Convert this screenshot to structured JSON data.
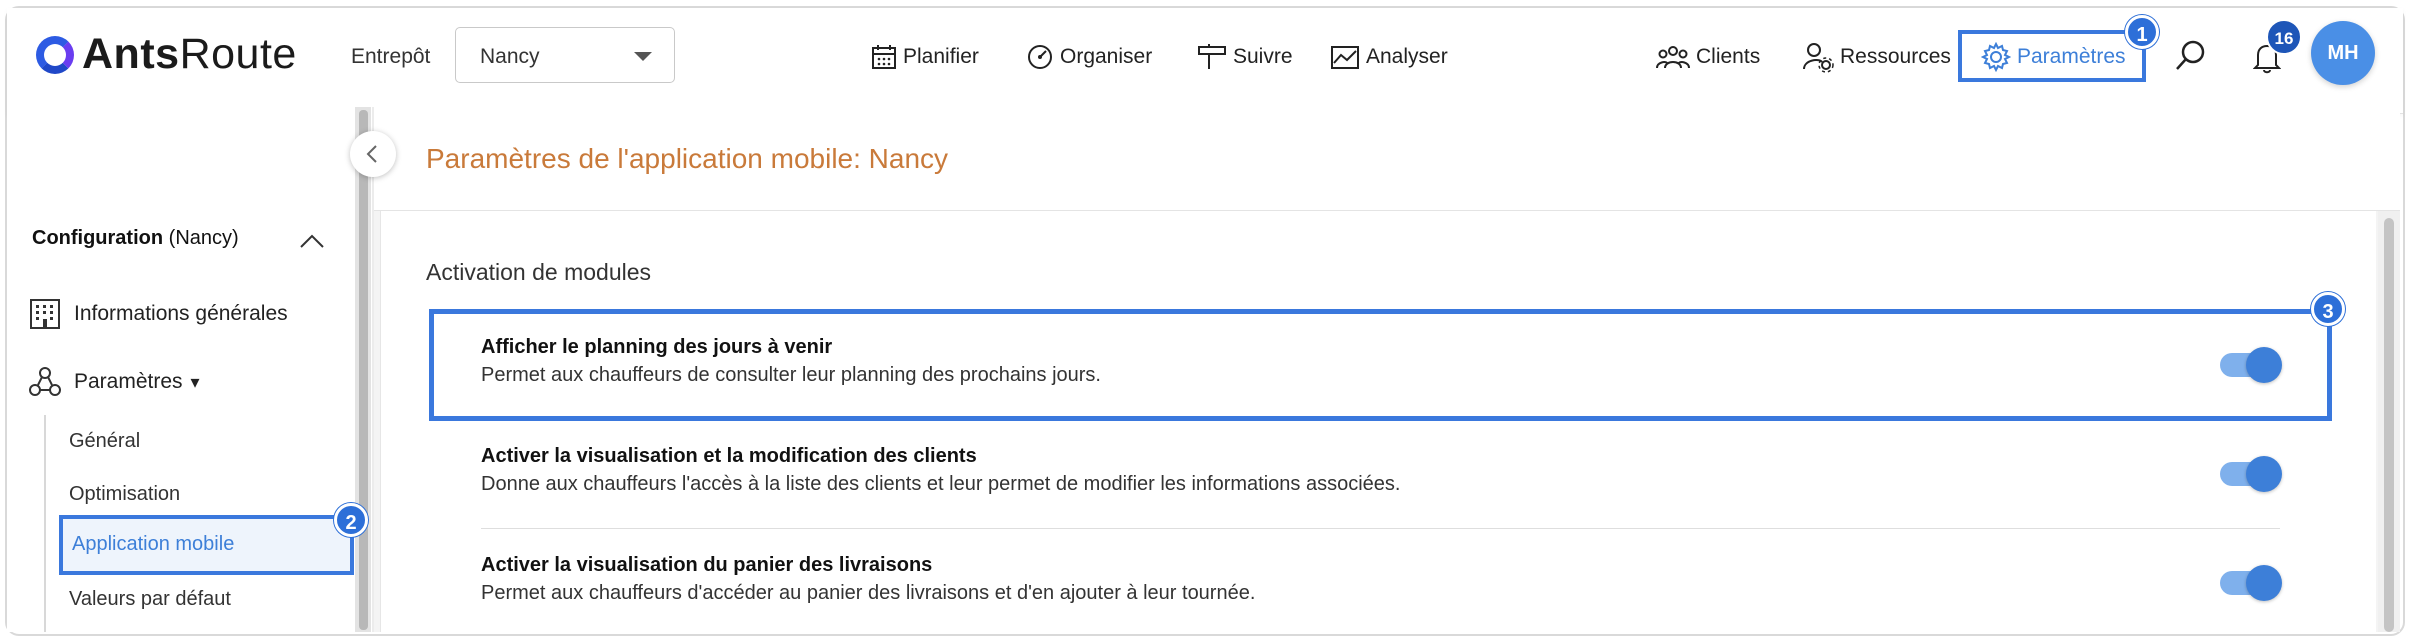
{
  "app": {
    "logo_bold": "Ants",
    "logo_light": "Route"
  },
  "header": {
    "warehouse_label": "Entrepôt",
    "warehouse_value": "Nancy",
    "nav": [
      {
        "label": "Planifier",
        "icon": "calendar-icon"
      },
      {
        "label": "Organiser",
        "icon": "gauge-icon"
      },
      {
        "label": "Suivre",
        "icon": "signpost-icon"
      },
      {
        "label": "Analyser",
        "icon": "chart-icon"
      }
    ],
    "right_nav": [
      {
        "label": "Clients",
        "icon": "users-icon"
      },
      {
        "label": "Ressources",
        "icon": "user-gear-icon"
      },
      {
        "label": "Paramètres",
        "icon": "gear-icon",
        "active": true
      }
    ],
    "notification_count": "16",
    "avatar_initials": "MH",
    "accent_color": "#3d7fd8"
  },
  "callouts": {
    "one": "1",
    "two": "2",
    "three": "3"
  },
  "sidebar": {
    "config_title_bold": "Configuration",
    "config_title_rest": "(Nancy)",
    "items": [
      {
        "label": "Informations générales",
        "icon": "building-icon"
      },
      {
        "label": "Paramètres",
        "icon": "settings-nodes-icon",
        "suffix": "▾"
      }
    ],
    "sub_items": [
      {
        "label": "Général"
      },
      {
        "label": "Optimisation"
      },
      {
        "label": "Application mobile",
        "active": true
      },
      {
        "label": "Valeurs par défaut"
      }
    ]
  },
  "main": {
    "page_title": "Paramètres de l'application mobile: Nancy",
    "section_title": "Activation de modules",
    "title_color": "#c97a3a",
    "modules": [
      {
        "title": "Afficher le planning des jours à venir",
        "description": "Permet aux chauffeurs de consulter leur planning des prochains jours.",
        "enabled": true
      },
      {
        "title": "Activer la visualisation et la modification des clients",
        "description": "Donne aux chauffeurs l'accès à la liste des clients et leur permet de modifier les informations associées.",
        "enabled": true
      },
      {
        "title": "Activer la visualisation du panier des livraisons",
        "description": "Permet aux chauffeurs d'accéder au panier des livraisons et d'en ajouter à leur tournée.",
        "enabled": true
      }
    ]
  }
}
